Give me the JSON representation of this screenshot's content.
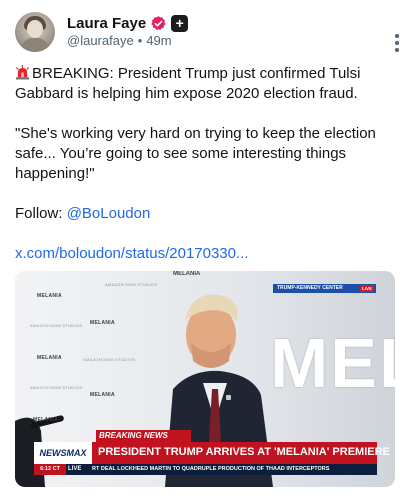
{
  "author": {
    "name": "Laura Faye",
    "handle": "@laurafaye",
    "separator": "•",
    "time_ago": "49m"
  },
  "post": {
    "para1": "BREAKING: President Trump just confirmed Tulsi Gabbard is helping him expose 2020 election fraud.",
    "para2": "\"She's working very hard on trying to keep the election safe... You’re going to see some interesting things happening!\"",
    "follow_prefix": "Follow: ",
    "follow_handle": "@BoLoudon",
    "link": "x.com/boloudon/status/20170330..."
  },
  "media": {
    "backdrop_title": "MELANIA",
    "backdrop_sub": "AMAZON MGM STUDIOS",
    "big_text": "MELA",
    "top_label": "MELANIA",
    "corner_feed": "TRUMP-KENNEDY CENTER",
    "corner_live": "LIVE",
    "breaking_label": "BREAKING NEWS",
    "network": "NEWSMAX",
    "headline": "PRESIDENT TRUMP ARRIVES AT 'MELANIA' PREMIERE",
    "time": "6:12 CT",
    "live": "LIVE",
    "ticker": "RT DEAL     LOCKHEED MARTIN TO QUADRUPLE PRODUCTION OF THAAD INTERCEPTORS"
  },
  "icons": {
    "verified": "verified-badge-icon",
    "subscription": "plus-badge-icon",
    "more": "more-vertical-icon",
    "siren": "siren-icon"
  },
  "colors": {
    "link": "#1d6ae6",
    "verified": "#e0245e",
    "newsmax_red": "#c1121f",
    "ticker_navy": "#0c1e3d"
  }
}
